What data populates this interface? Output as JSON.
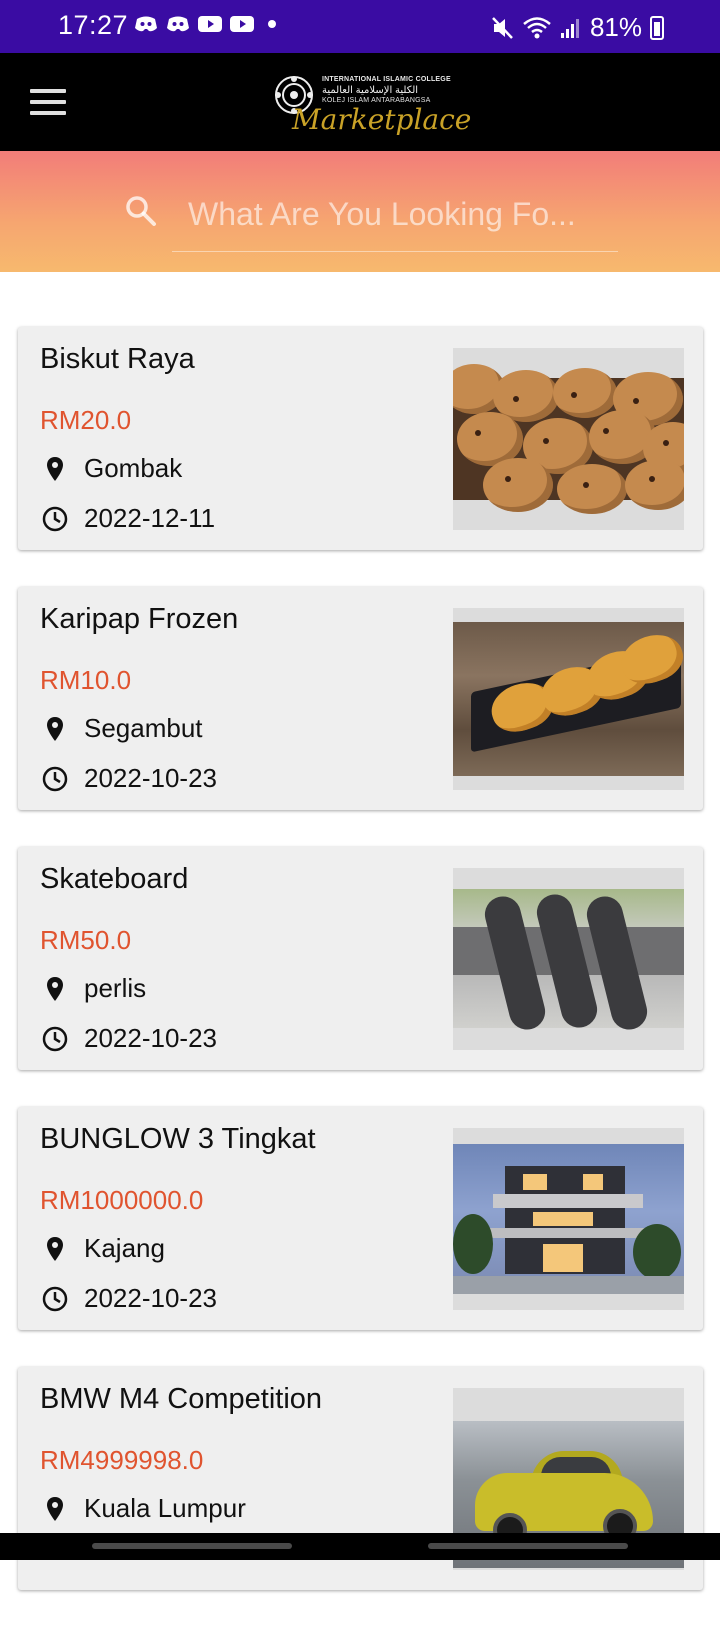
{
  "status_bar": {
    "time": "17:27",
    "battery": "81%"
  },
  "app_bar": {
    "logo": {
      "line1": "INTERNATIONAL ISLAMIC COLLEGE",
      "line2": "الكلية الإسلامية العالمية",
      "line3": "KOLEJ ISLAM ANTARABANGSA",
      "script": "Marketplace"
    }
  },
  "search": {
    "placeholder": "What Are You Looking Fo..."
  },
  "listings": [
    {
      "title": "Biskut Raya",
      "price": "RM20.0",
      "location": "Gombak",
      "date": "2022-12-11",
      "image": "cookies"
    },
    {
      "title": "Karipap Frozen",
      "price": "RM10.0",
      "location": "Segambut",
      "date": "2022-10-23",
      "image": "karipap"
    },
    {
      "title": "Skateboard",
      "price": "RM50.0",
      "location": "perlis",
      "date": "2022-10-23",
      "image": "skateboards"
    },
    {
      "title": "BUNGLOW 3 Tingkat",
      "price": "RM1000000.0",
      "location": "Kajang",
      "date": "2022-10-23",
      "image": "bungalow-house"
    },
    {
      "title": "BMW M4 Competition",
      "price": "RM4999998.0",
      "location": "Kuala Lumpur",
      "date": "",
      "image": "yellow-bmw-car"
    }
  ],
  "colors": {
    "status_bar": "#3a0ca3",
    "app_bar": "#000000",
    "banner_top": "#f27d79",
    "banner_bottom": "#f7b96e",
    "price": "#e0542f",
    "card_bg": "#efefef"
  }
}
